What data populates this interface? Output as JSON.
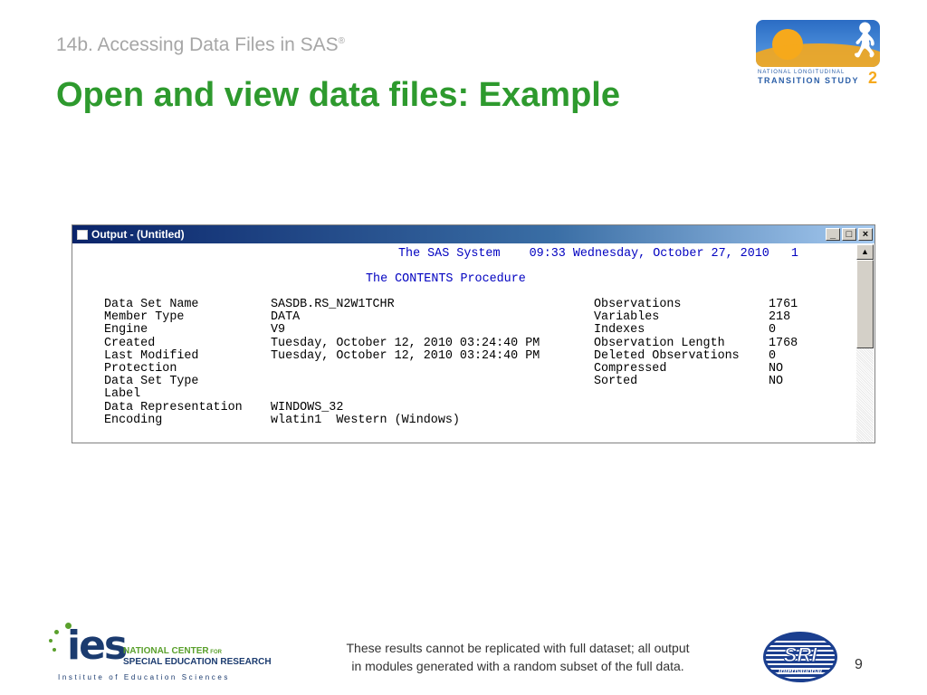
{
  "slide": {
    "subtitle": "14b. Accessing Data Files in SAS",
    "subtitle_mark": "®",
    "title": "Open and view data files: Example",
    "footer_note_line1": "These results cannot be replicated with full dataset; all output",
    "footer_note_line2": "in modules generated with a random subset of the full data.",
    "page_number": "9"
  },
  "logos": {
    "nlts_small": "NATIONAL LONGITUDINAL",
    "nlts_big": "TRANSITION STUDY",
    "nlts_num": "2",
    "ies_word": "ies",
    "ies_line1": "NATIONAL CENTER",
    "ies_line1_small": " FOR",
    "ies_line2": "SPECIAL EDUCATION RESEARCH",
    "ies_line3": "Institute of Education Sciences",
    "sri_text": "SRI",
    "sri_sub": "International",
    "sri_mark": "®"
  },
  "window": {
    "title": "Output - (Untitled)",
    "minimize": "_",
    "maximize": "□",
    "close": "×",
    "header_line": "The SAS System    09:33 Wednesday, October 27, 2010   1",
    "procedure_line": "The CONTENTS Procedure",
    "left_labels": [
      "Data Set Name",
      "Member Type",
      "Engine",
      "Created",
      "Last Modified",
      "Protection",
      "Data Set Type",
      "Label",
      "Data Representation",
      "Encoding"
    ],
    "left_values": [
      "SASDB.RS_N2W1TCHR",
      "DATA",
      "V9",
      "Tuesday, October 12, 2010 03:24:40 PM",
      "Tuesday, October 12, 2010 03:24:40 PM",
      "",
      "",
      "",
      "WINDOWS_32",
      "wlatin1  Western (Windows)"
    ],
    "right_labels": [
      "Observations",
      "Variables",
      "Indexes",
      "Observation Length",
      "Deleted Observations",
      "Compressed",
      "Sorted"
    ],
    "right_values": [
      "1761",
      "218",
      "0",
      "1768",
      "0",
      "NO",
      "NO"
    ]
  },
  "colors": {
    "title_green": "#2e9a2e",
    "sas_blue": "#0000c0"
  }
}
